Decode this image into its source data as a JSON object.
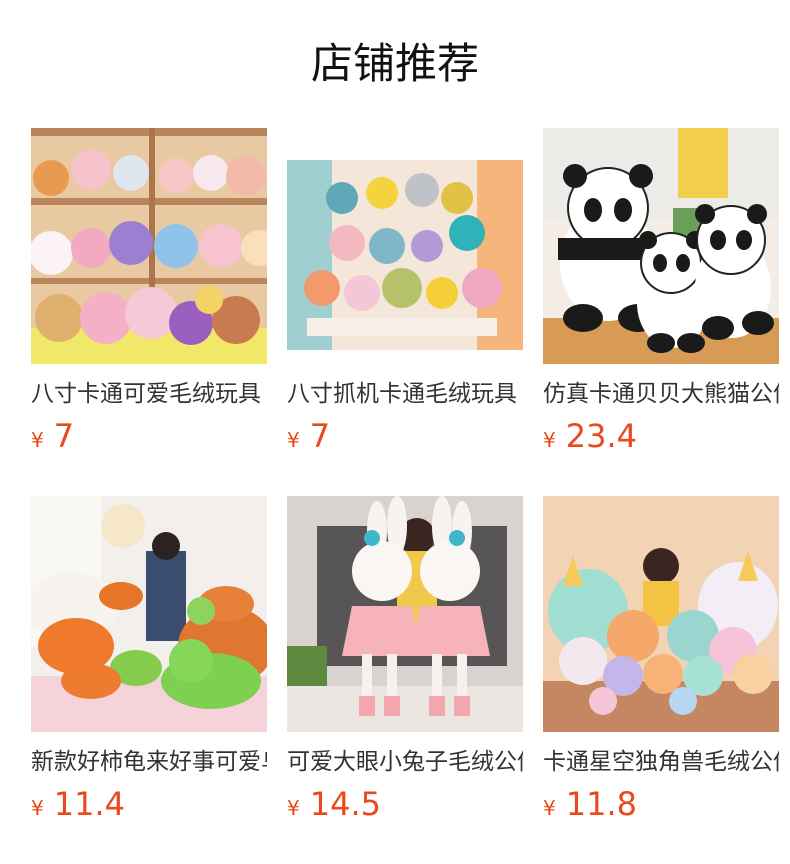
{
  "section_title": "店铺推荐",
  "currency_symbol": "¥",
  "accent_color": "#e84a1b",
  "products": [
    {
      "name": "八寸卡通可爱毛绒玩具",
      "price": "7",
      "image": "plush-shelf-photo"
    },
    {
      "name": "八寸抓机卡通毛绒玩具",
      "price": "7",
      "image": "plush-group-photo"
    },
    {
      "name": "仿真卡通贝贝大熊猫公仔",
      "price": "23.4",
      "image": "panda-plush-photo"
    },
    {
      "name": "新款好柿龟来好事可爱乌龟公仔",
      "price": "11.4",
      "image": "turtle-plush-photo"
    },
    {
      "name": "可爱大眼小兔子毛绒公仔",
      "price": "14.5",
      "image": "rabbit-plush-photo"
    },
    {
      "name": "卡通星空独角兽毛绒公仔",
      "price": "11.8",
      "image": "unicorn-plush-photo"
    }
  ]
}
